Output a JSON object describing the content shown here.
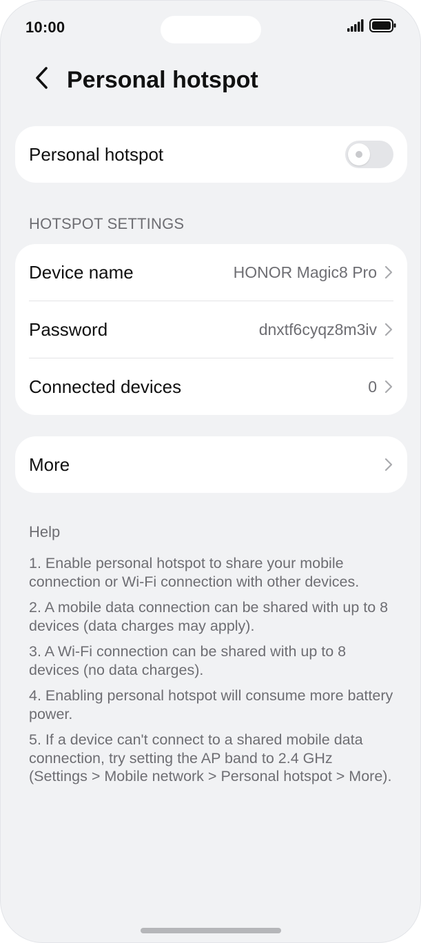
{
  "status_bar": {
    "time": "10:00",
    "icons": [
      "signal-icon",
      "battery-icon"
    ]
  },
  "header": {
    "back_icon": "chevron-left-icon",
    "title": "Personal hotspot"
  },
  "hotspot_toggle": {
    "label": "Personal hotspot",
    "enabled": false
  },
  "hotspot_settings": {
    "section_title": "HOTSPOT SETTINGS",
    "rows": [
      {
        "label": "Device name",
        "value": "HONOR Magic8 Pro"
      },
      {
        "label": "Password",
        "value": "dnxtf6cyqz8m3iv"
      },
      {
        "label": "Connected devices",
        "value": "0"
      }
    ]
  },
  "more": {
    "label": "More"
  },
  "help": {
    "title": "Help",
    "items": [
      "1. Enable personal hotspot to share your mobile connection or Wi-Fi connection with other devices.",
      "2. A mobile data connection can be shared with up to 8 devices (data charges may apply).",
      "3. A Wi-Fi connection can be shared with up to 8 devices (no data charges).",
      "4. Enabling personal hotspot will consume more battery power.",
      "5. If a device can't connect to a shared mobile data connection, try setting the AP band to 2.4 GHz (Settings > Mobile network > Personal hotspot > More)."
    ]
  },
  "colors": {
    "background": "#f1f2f4",
    "card": "#ffffff",
    "primary_text": "#111111",
    "secondary_text": "#6e6e73",
    "toggle_off": "#e4e5e8"
  }
}
